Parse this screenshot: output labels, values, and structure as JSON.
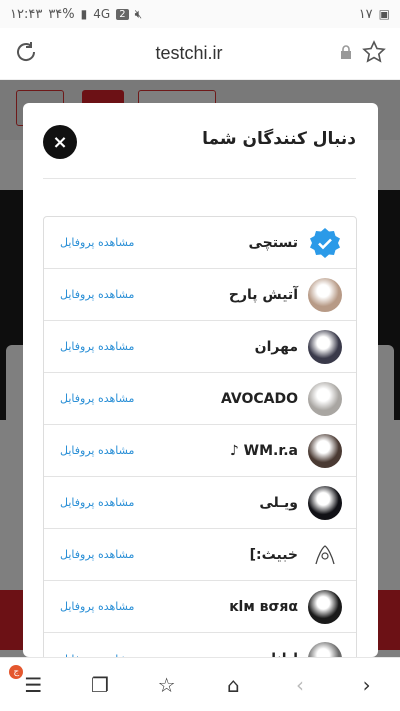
{
  "status": {
    "time": "۱۲:۴۳",
    "battery": "۳۴%",
    "sim": "2",
    "network": "4G",
    "date": "۱۷"
  },
  "browser": {
    "url": "testchi.ir"
  },
  "modal": {
    "title": "دنبال کنندگان شما",
    "close_label": "×",
    "view_profile_label": "مشاهده پروفایل",
    "followers": [
      {
        "name": "تستچی",
        "avatar": "verified-badge",
        "color": "#2b9ae8"
      },
      {
        "name": "آتیش پارح",
        "avatar": "cat-photo",
        "color": "#b79a86"
      },
      {
        "name": "مهران",
        "avatar": "portrait-photo",
        "color": "#3a3a4a"
      },
      {
        "name": "AVOCADO",
        "avatar": "portrait-photo",
        "color": "#a9a6a2"
      },
      {
        "name": "WM.r.a ♪",
        "avatar": "portrait-photo",
        "color": "#4a3a33"
      },
      {
        "name": "ویـلی",
        "avatar": "character-photo",
        "color": "#111116"
      },
      {
        "name": "خبیث:]",
        "avatar": "sketch-icon",
        "color": "#ffffff"
      },
      {
        "name": "ĸlм вσяα",
        "avatar": "dark-photo",
        "color": "#1a1a1a"
      },
      {
        "name": "لیانا",
        "avatar": "portrait-photo",
        "color": "#6a6a6a"
      }
    ]
  },
  "bottom_nav": {
    "menu_badge": "ج"
  }
}
